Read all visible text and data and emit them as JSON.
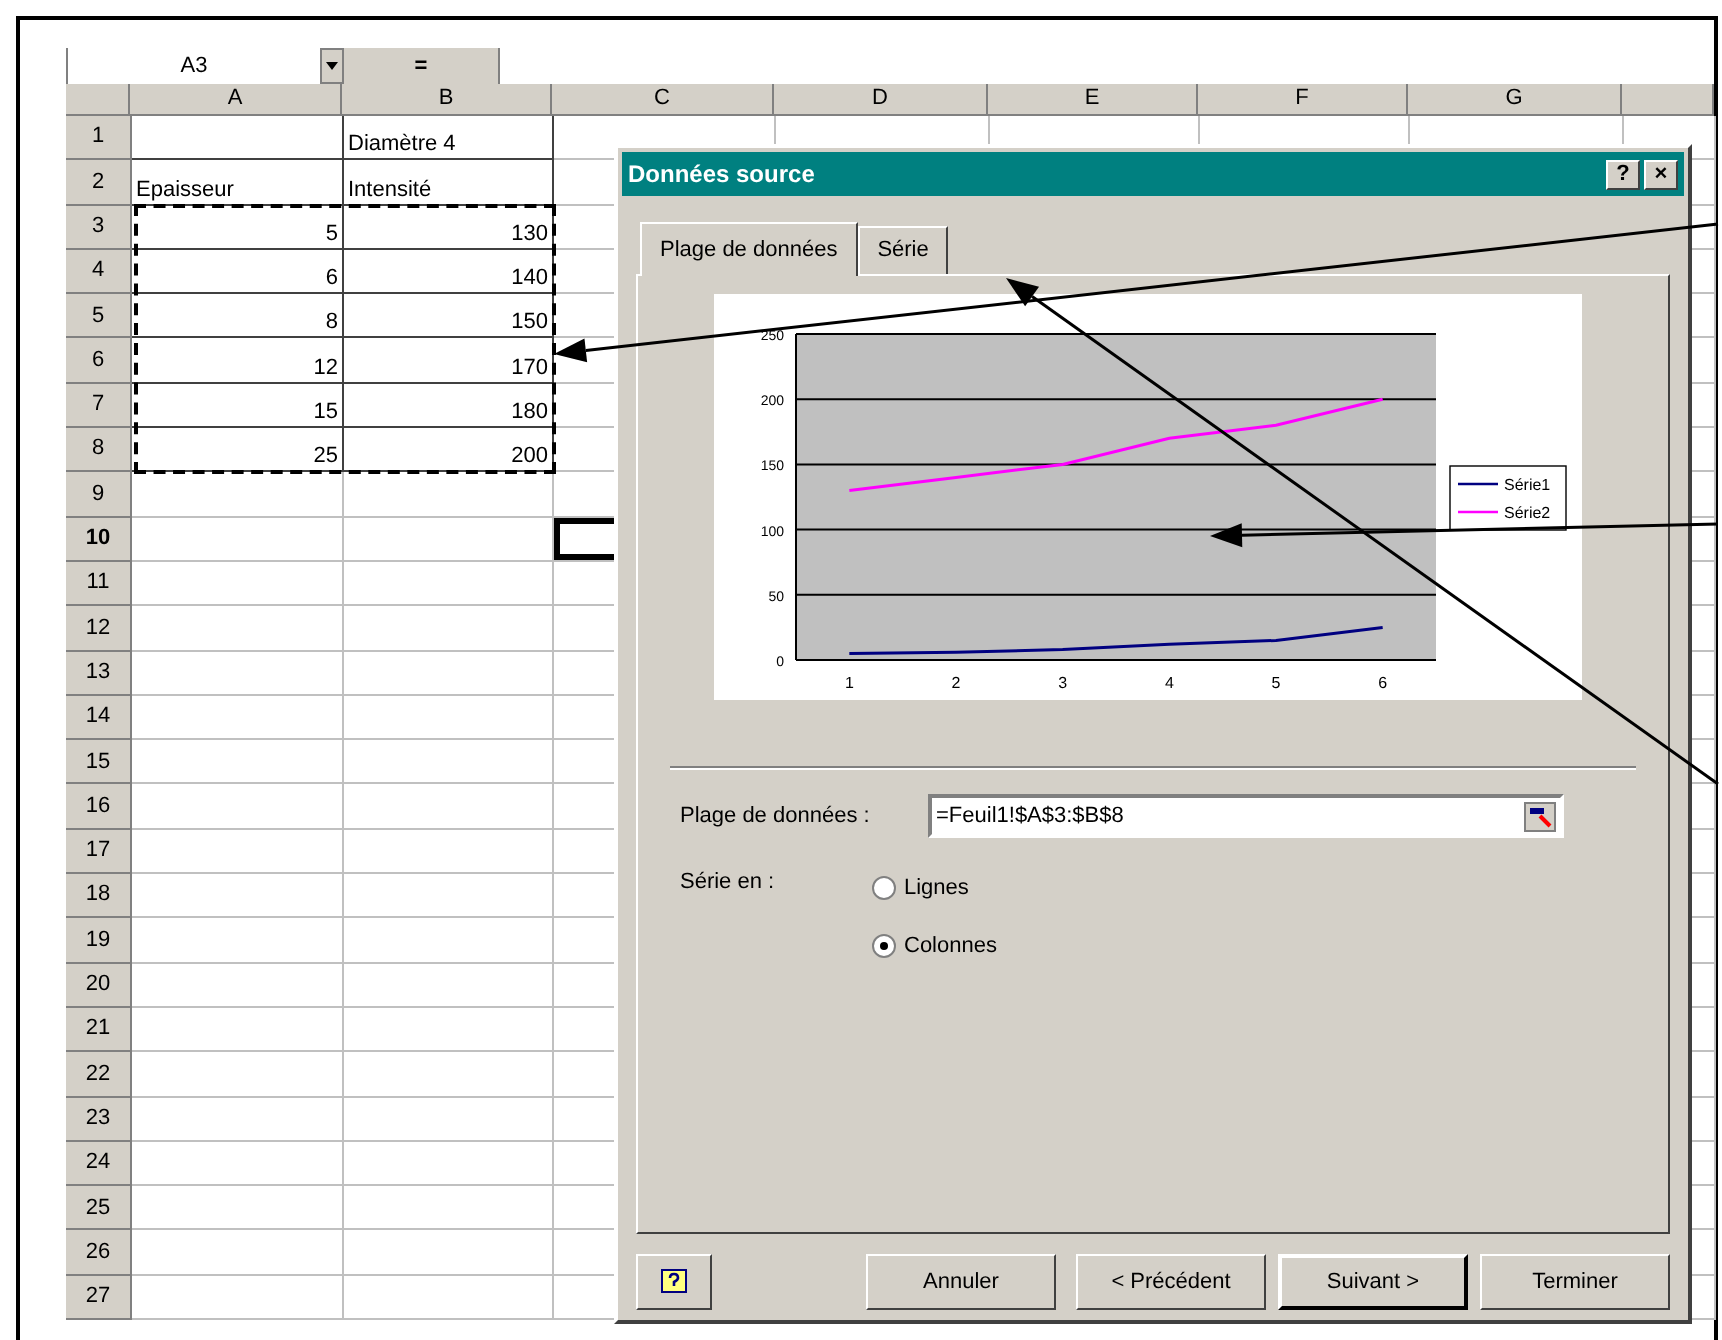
{
  "name_box": {
    "value": "A3"
  },
  "formula_bar": {
    "button": "="
  },
  "sheet": {
    "columns": [
      "A",
      "B",
      "C",
      "D",
      "E",
      "F",
      "G"
    ],
    "copy_marquee": true,
    "rows": [
      {
        "header": "1",
        "selected": false,
        "col_b": {
          "text": "Diamètre 4",
          "right_aligned": false
        }
      },
      {
        "header": "2",
        "selected": false,
        "col_a": {
          "text": "Epaisseur",
          "right_aligned": false
        },
        "col_b": {
          "text": "Intensité",
          "right_aligned": false
        }
      },
      {
        "header": "3",
        "selected": false,
        "col_a": {
          "text": "5",
          "right_aligned": true
        },
        "col_b": {
          "text": "130",
          "right_aligned": true
        }
      },
      {
        "header": "4",
        "selected": false,
        "col_a": {
          "text": "6",
          "right_aligned": true
        },
        "col_b": {
          "text": "140",
          "right_aligned": true
        }
      },
      {
        "header": "5",
        "selected": false,
        "col_a": {
          "text": "8",
          "right_aligned": true
        },
        "col_b": {
          "text": "150",
          "right_aligned": true
        }
      },
      {
        "header": "6",
        "selected": false,
        "col_a": {
          "text": "12",
          "right_aligned": true
        },
        "col_b": {
          "text": "170",
          "right_aligned": true
        }
      },
      {
        "header": "7",
        "selected": false,
        "col_a": {
          "text": "15",
          "right_aligned": true
        },
        "col_b": {
          "text": "180",
          "right_aligned": true
        }
      },
      {
        "header": "8",
        "selected": false,
        "col_a": {
          "text": "25",
          "right_aligned": true
        },
        "col_b": {
          "text": "200",
          "right_aligned": true
        }
      },
      {
        "header": "9",
        "selected": false
      },
      {
        "header": "10",
        "selected": true
      },
      {
        "header": "11",
        "selected": false
      },
      {
        "header": "12",
        "selected": false
      },
      {
        "header": "13",
        "selected": false
      },
      {
        "header": "14",
        "selected": false
      },
      {
        "header": "15",
        "selected": false
      },
      {
        "header": "16",
        "selected": false
      },
      {
        "header": "17",
        "selected": false
      },
      {
        "header": "18",
        "selected": false
      },
      {
        "header": "19",
        "selected": false
      },
      {
        "header": "20",
        "selected": false
      },
      {
        "header": "21",
        "selected": false
      },
      {
        "header": "22",
        "selected": false
      },
      {
        "header": "23",
        "selected": false
      },
      {
        "header": "24",
        "selected": false
      },
      {
        "header": "25",
        "selected": false
      },
      {
        "header": "26",
        "selected": false
      },
      {
        "header": "27",
        "selected": false
      }
    ]
  },
  "dialog": {
    "title": "Données source",
    "title_buttons": [
      "?",
      "×"
    ],
    "tabs": [
      {
        "label": "Plage de données",
        "selected": true
      },
      {
        "label": "Série",
        "selected": false
      }
    ],
    "chart_data": {
      "type": "line",
      "categories": [
        "1",
        "2",
        "3",
        "4",
        "5",
        "6"
      ],
      "ylim": [
        0,
        250
      ],
      "yticks": [
        0,
        50,
        100,
        150,
        200,
        250
      ],
      "grid": true,
      "legend": "right",
      "series": [
        {
          "name": "Série1",
          "color": "#000080",
          "values": [
            5,
            6,
            8,
            12,
            15,
            25
          ]
        },
        {
          "name": "Série2",
          "color": "#ff00ff",
          "values": [
            130,
            140,
            150,
            170,
            180,
            200
          ]
        }
      ]
    },
    "range_field": {
      "label": "Plage de données :",
      "value": "=Feuil1!$A$3:$B$8"
    },
    "series_in": {
      "label": "Série en :",
      "options": [
        {
          "label": "Lignes",
          "selected": false
        },
        {
          "label": "Colonnes",
          "selected": true
        }
      ]
    },
    "buttons": [
      {
        "label": "Annuler",
        "kind": "normal"
      },
      {
        "label": "< Précédent",
        "kind": "normal"
      },
      {
        "label": "Suivant >",
        "kind": "default"
      },
      {
        "label": "Terminer",
        "kind": "normal"
      }
    ]
  }
}
